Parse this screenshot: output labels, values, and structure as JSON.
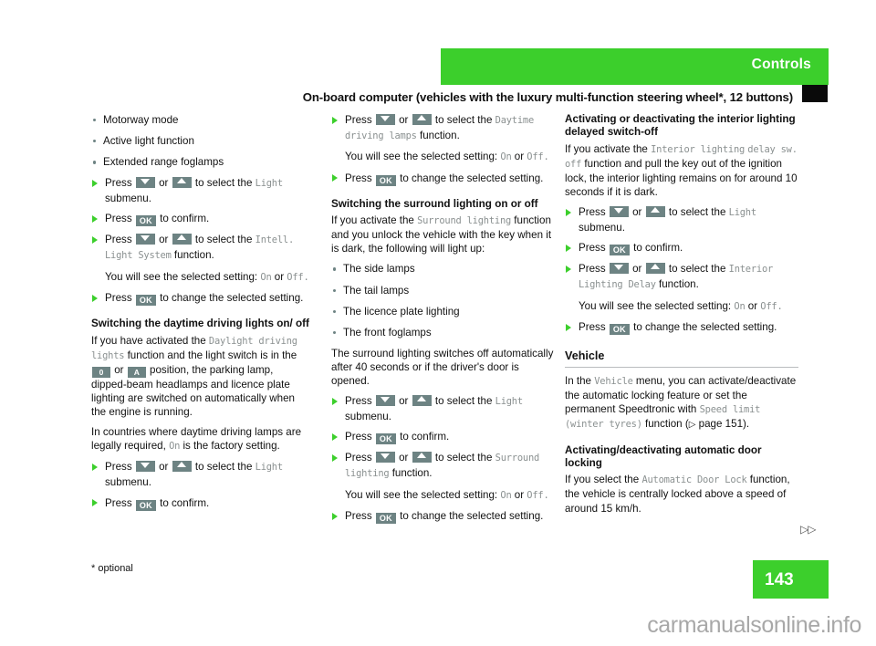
{
  "header": {
    "band_label": "Controls",
    "band_color": "#3ccf2c",
    "tab_marker_color": "#0a0a0a",
    "doc_title": "On-board computer (vehicles with the luxury multi-function steering wheel*, 12 buttons)"
  },
  "keys": {
    "ok": "OK",
    "switch_off": "0",
    "switch_auto": "A",
    "down": "down-arrow-key",
    "up": "up-arrow-key"
  },
  "column1": {
    "bullets": [
      "Motorway mode",
      "Active light function",
      "Extended range foglamps"
    ],
    "step_press_1_a": "Press",
    "step_press_1_or": "or",
    "step_press_1_b": "to select the",
    "step_press_1_menu": "Light",
    "step_press_1_c": "submenu.",
    "step_press_2_a": "Press",
    "step_press_2_b": "to confirm.",
    "step_press_3_a": "Press",
    "step_press_3_or": "or",
    "step_press_3_b": "to select the",
    "step_press_3_menu1": "Intell.",
    "step_press_3_menu2": "Light System",
    "step_press_3_c": "function.",
    "note_setting_a": "You will see the selected setting:",
    "note_setting_on": "On",
    "note_setting_or": "or",
    "note_setting_off": "Off.",
    "step_press_4_a": "Press",
    "step_press_4_b": "to change the selected setting.",
    "heading_daytime": "Switching the daytime driving lights on/ off",
    "para_daytime_1a": "If you have activated the",
    "para_daytime_mono1": "Daylight driving lights",
    "para_daytime_1b": "function and the light switch is in the",
    "para_daytime_1c": "or",
    "para_daytime_1d": "position, the parking lamp, dipped-beam headlamps and licence plate lighting are switched on automatically when the engine is running.",
    "para_daytime_2a": "In countries where daytime driving lamps are legally required,",
    "para_daytime_2_on": "On",
    "para_daytime_2b": "is the factory setting.",
    "step_press_5_a": "Press",
    "step_press_5_or": "or",
    "step_press_5_b": "to select the",
    "step_press_5_menu": "Light",
    "step_press_5_c": "submenu.",
    "step_press_6_a": "Press",
    "step_press_6_b": "to confirm."
  },
  "column2": {
    "step_press_1_a": "Press",
    "step_press_1_or": "or",
    "step_press_1_b": "to select the",
    "step_press_1_menu1": "Daytime",
    "step_press_1_menu2": "driving lamps",
    "step_press_1_c": "function.",
    "note_setting_a": "You will see the selected setting:",
    "note_setting_on": "On",
    "note_setting_or": "or",
    "note_setting_off": "Off.",
    "step_press_2_a": "Press",
    "step_press_2_b": "to change the selected setting.",
    "heading_surround": "Switching the surround lighting on or off",
    "para_surround_a": "If you activate the",
    "para_surround_mono": "Surround lighting",
    "para_surround_b": "function and you unlock the vehicle with the key when it is dark, the following will light up:",
    "bullets": [
      "The side lamps",
      "The tail lamps",
      "The licence plate lighting",
      "The front foglamps"
    ],
    "para_auto_off": "The surround lighting switches off automatically after 40 seconds or if the driver's door is opened.",
    "step_press_3_a": "Press",
    "step_press_3_or": "or",
    "step_press_3_b": "to select the",
    "step_press_3_menu": "Light",
    "step_press_3_c": "submenu.",
    "step_press_4_a": "Press",
    "step_press_4_b": "to confirm.",
    "step_press_5_a": "Press",
    "step_press_5_or": "or",
    "step_press_5_b": "to select the",
    "step_press_5_menu1": "Surround",
    "step_press_5_menu2": "lighting",
    "step_press_5_c": "function.",
    "note_setting2_a": "You will see the selected setting:",
    "note_setting2_on": "On",
    "note_setting2_or": "or",
    "note_setting2_off": "Off.",
    "step_press_6_a": "Press",
    "step_press_6_b": "to change the selected setting."
  },
  "column3": {
    "heading_interior": "Activating or deactivating the interior lighting delayed switch-off",
    "para_interior_a": "If you activate the",
    "para_interior_mono1": "Interior lighting",
    "para_interior_mono2": "delay sw. off",
    "para_interior_b": "function and pull the key out of the ignition lock, the interior lighting remains on for around 10 seconds if it is dark.",
    "step_press_1_a": "Press",
    "step_press_1_or": "or",
    "step_press_1_b": "to select the",
    "step_press_1_menu": "Light",
    "step_press_1_c": "submenu.",
    "step_press_2_a": "Press",
    "step_press_2_b": "to confirm.",
    "step_press_3_a": "Press",
    "step_press_3_or": "or",
    "step_press_3_b": "to select the",
    "step_press_3_menu1": "Interior",
    "step_press_3_menu2": "Lighting Delay",
    "step_press_3_c": "function.",
    "note_setting_a": "You will see the selected setting:",
    "note_setting_on": "On",
    "note_setting_or": "or",
    "note_setting_off": "Off.",
    "step_press_4_a": "Press",
    "step_press_4_b": "to change the selected setting.",
    "heading_vehicle": "Vehicle",
    "para_vehicle_a": "In the",
    "para_vehicle_mono1": "Vehicle",
    "para_vehicle_b": "menu, you can activate/deactivate the automatic locking feature or set the permanent Speedtronic with",
    "para_vehicle_mono2": "Speed limit (winter tyres)",
    "para_vehicle_c": "function (",
    "para_vehicle_ref": "page 151).",
    "para_vehicle_ref_arrow": "▷",
    "heading_autolock": "Activating/deactivating automatic door locking",
    "para_autolock_a": "If you select the",
    "para_autolock_mono": "Automatic Door Lock",
    "para_autolock_b": "function, the vehicle is centrally locked above a speed of around 15 km/h."
  },
  "footer": {
    "footnote": "* optional",
    "continue_arrows": "▷▷",
    "page_number": "143",
    "page_badge_color": "#3ccf2c",
    "watermark": "carmanualsonline.info"
  }
}
